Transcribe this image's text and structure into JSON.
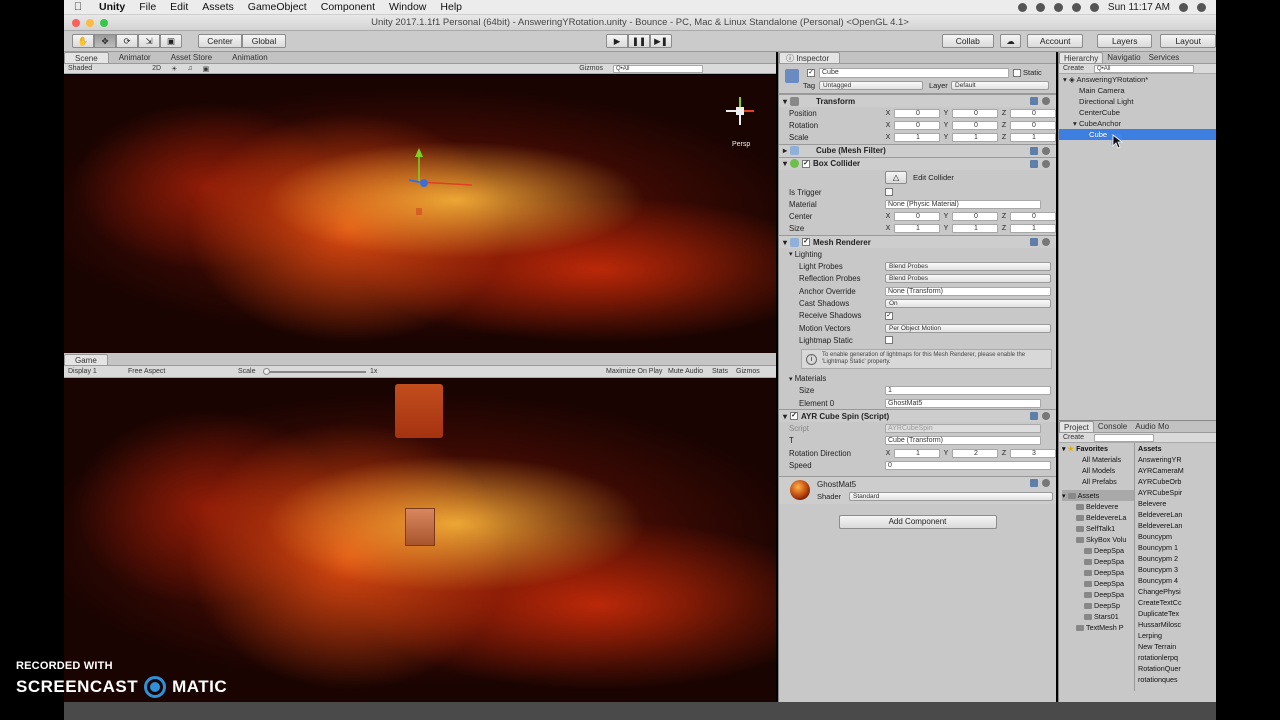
{
  "mac_menu": {
    "app": "Unity",
    "items": [
      "File",
      "Edit",
      "Assets",
      "GameObject",
      "Component",
      "Window",
      "Help"
    ],
    "clock": "Sun 11:17 AM"
  },
  "window_title": "Unity 2017.1.1f1 Personal (64bit) - AnsweringYRotation.unity - Bounce - PC, Mac & Linux Standalone (Personal) <OpenGL 4.1>",
  "toolbar": {
    "pivot": "Center",
    "space": "Global",
    "collab": "Collab",
    "account": "Account",
    "layers": "Layers",
    "layout": "Layout"
  },
  "scene": {
    "tabs": [
      "Scene",
      "Animator",
      "Asset Store",
      "Animation"
    ],
    "shading": "Shaded",
    "mode_2d": "2D",
    "gizmos": "Gizmos",
    "search_placeholder": "Q•All",
    "persp": "Persp"
  },
  "game": {
    "tab": "Game",
    "display": "Display 1",
    "aspect": "Free Aspect",
    "scale_label": "Scale",
    "scale_value": "1x",
    "maximize": "Maximize On Play",
    "mute": "Mute Audio",
    "stats": "Stats",
    "gizmos": "Gizmos"
  },
  "inspector": {
    "tab": "Inspector",
    "object_name": "Cube",
    "static": "Static",
    "tag_label": "Tag",
    "tag_value": "Untagged",
    "layer_label": "Layer",
    "layer_value": "Default",
    "transform": {
      "title": "Transform",
      "position": {
        "label": "Position",
        "x": "0",
        "y": "0",
        "z": "0"
      },
      "rotation": {
        "label": "Rotation",
        "x": "0",
        "y": "0",
        "z": "0"
      },
      "scale": {
        "label": "Scale",
        "x": "1",
        "y": "1",
        "z": "1"
      }
    },
    "mesh_filter": "Cube (Mesh Filter)",
    "box_collider": {
      "title": "Box Collider",
      "edit_button": "Edit Collider",
      "is_trigger": "Is Trigger",
      "material_label": "Material",
      "material_value": "None (Physic Material)",
      "center": {
        "label": "Center",
        "x": "0",
        "y": "0",
        "z": "0"
      },
      "size": {
        "label": "Size",
        "x": "1",
        "y": "1",
        "z": "1"
      }
    },
    "mesh_renderer": {
      "title": "Mesh Renderer",
      "lighting": "Lighting",
      "light_probes_label": "Light Probes",
      "light_probes_value": "Blend Probes",
      "reflection_probes_label": "Reflection Probes",
      "reflection_probes_value": "Blend Probes",
      "anchor_override_label": "Anchor Override",
      "anchor_override_value": "None (Transform)",
      "cast_shadows_label": "Cast Shadows",
      "cast_shadows_value": "On",
      "receive_shadows_label": "Receive Shadows",
      "motion_vectors_label": "Motion Vectors",
      "motion_vectors_value": "Per Object Motion",
      "lightmap_static_label": "Lightmap Static",
      "info": "To enable generation of lightmaps for this Mesh Renderer, please enable the 'Lightmap Static' property.",
      "materials": "Materials",
      "size_label": "Size",
      "size_value": "1",
      "element0_label": "Element 0",
      "element0_value": "GhostMat5"
    },
    "script": {
      "title": "AYR Cube Spin (Script)",
      "script_label": "Script",
      "script_value": "AYRCubeSpin",
      "t_label": "T",
      "t_value": "Cube (Transform)",
      "rotation_direction": {
        "label": "Rotation Direction",
        "x": "1",
        "y": "2",
        "z": "3"
      },
      "speed_label": "Speed",
      "speed_value": "0"
    },
    "material": {
      "name": "GhostMat5",
      "shader_label": "Shader",
      "shader_value": "Standard"
    },
    "add_component": "Add Component"
  },
  "hierarchy": {
    "tabs": [
      "Hierarchy",
      "Navigatio",
      "Services"
    ],
    "create": "Create",
    "search_placeholder": "Q•All",
    "scene_name": "AnsweringYRotation*",
    "items": [
      "Main Camera",
      "Directional Light",
      "CenterCube",
      "CubeAnchor",
      "Cube"
    ]
  },
  "project": {
    "tabs": [
      "Project",
      "Console",
      "Audio Mo"
    ],
    "create": "Create",
    "favorites_label": "Favorites",
    "favorites": [
      "All Materials",
      "All Models",
      "All Prefabs"
    ],
    "assets_label": "Assets",
    "folders": [
      "Beldevere",
      "BeldevereLa",
      "SelfTalk1",
      "SkyBox Volu",
      "DeepSpa",
      "DeepSpa",
      "DeepSpa",
      "DeepSpa",
      "DeepSpa",
      "DeepSp",
      "Stars01",
      "TextMesh P"
    ],
    "assets_header": "Assets",
    "assets": [
      "AnsweringYR",
      "AYRCameraM",
      "AYRCubeOrb",
      "AYRCubeSpir",
      "Belevere",
      "BeldevereLan",
      "BeldevereLan",
      "Bouncypm",
      "Bouncypm 1",
      "Bouncypm 2",
      "Bouncypm 3",
      "Bouncypm 4",
      "ChangePhysi",
      "CreateTextCc",
      "DuplicateTex",
      "HussarMilosc",
      "Lerping",
      "New Terrain",
      "rotationlerpq",
      "RotationQuer",
      "rotationques"
    ]
  },
  "watermark": {
    "line1": "RECORDED WITH",
    "left": "SCREENCAST",
    "right": "MATIC"
  },
  "colors": {
    "selection": "#3d7fe0",
    "panel_bg": "#c8c8c8",
    "nebula_core": "#ff5a14"
  }
}
